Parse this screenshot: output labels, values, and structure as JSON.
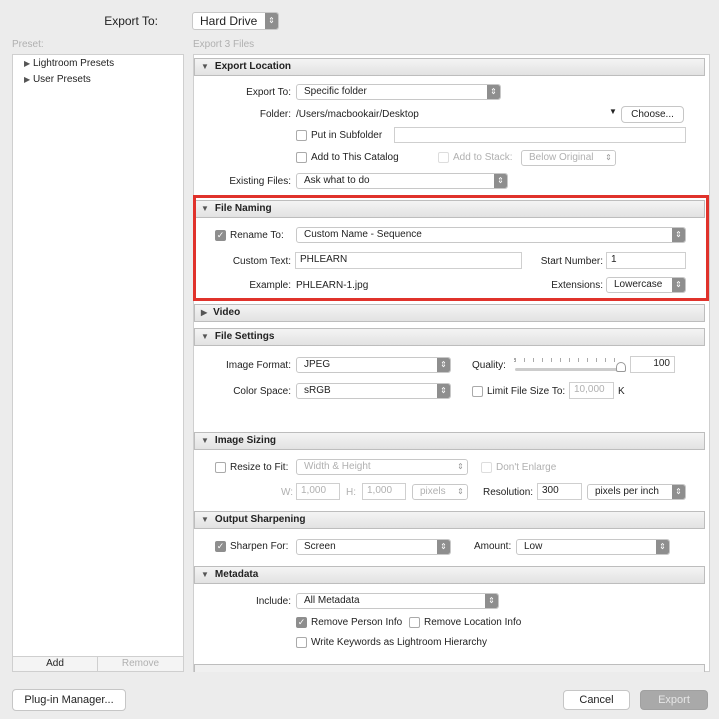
{
  "header": {
    "export_to_label": "Export To:",
    "export_to_value": "Hard Drive"
  },
  "preset_label": "Preset:",
  "files_label": "Export 3 Files",
  "presets": [
    {
      "label": "Lightroom Presets"
    },
    {
      "label": "User Presets"
    }
  ],
  "preset_buttons": {
    "add": "Add",
    "remove": "Remove"
  },
  "export_location": {
    "title": "Export Location",
    "export_to_label": "Export To:",
    "export_to_value": "Specific folder",
    "folder_label": "Folder:",
    "folder_value": "/Users/macbookair/Desktop",
    "choose": "Choose...",
    "subfolder_label": "Put in Subfolder",
    "add_catalog_label": "Add to This Catalog",
    "add_stack_label": "Add to Stack:",
    "stack_value": "Below Original",
    "existing_label": "Existing Files:",
    "existing_value": "Ask what to do"
  },
  "file_naming": {
    "title": "File Naming",
    "rename_label": "Rename To:",
    "rename_value": "Custom Name - Sequence",
    "custom_text_label": "Custom Text:",
    "custom_text_value": "PHLEARN",
    "start_number_label": "Start Number:",
    "start_number_value": "1",
    "example_label": "Example:",
    "example_value": "PHLEARN-1.jpg",
    "extensions_label": "Extensions:",
    "extensions_value": "Lowercase",
    "highlight_color": "#e0322b"
  },
  "video": {
    "title": "Video"
  },
  "file_settings": {
    "title": "File Settings",
    "format_label": "Image Format:",
    "format_value": "JPEG",
    "quality_label": "Quality:",
    "quality_value": "100",
    "color_space_label": "Color Space:",
    "color_space_value": "sRGB",
    "limit_label": "Limit File Size To:",
    "limit_value": "10,000",
    "limit_unit": "K"
  },
  "image_sizing": {
    "title": "Image Sizing",
    "resize_label": "Resize to Fit:",
    "resize_value": "Width & Height",
    "dont_enlarge": "Don't Enlarge",
    "w_label": "W:",
    "w_value": "1,000",
    "h_label": "H:",
    "h_value": "1,000",
    "unit_value": "pixels",
    "resolution_label": "Resolution:",
    "resolution_value": "300",
    "resolution_unit": "pixels per inch"
  },
  "output_sharpening": {
    "title": "Output Sharpening",
    "sharpen_label": "Sharpen For:",
    "sharpen_value": "Screen",
    "amount_label": "Amount:",
    "amount_value": "Low"
  },
  "metadata": {
    "title": "Metadata",
    "include_label": "Include:",
    "include_value": "All Metadata",
    "remove_person": "Remove Person Info",
    "remove_location": "Remove Location Info",
    "write_keywords": "Write Keywords as Lightroom Hierarchy"
  },
  "footer": {
    "plugin_manager": "Plug-in Manager...",
    "cancel": "Cancel",
    "export": "Export"
  }
}
